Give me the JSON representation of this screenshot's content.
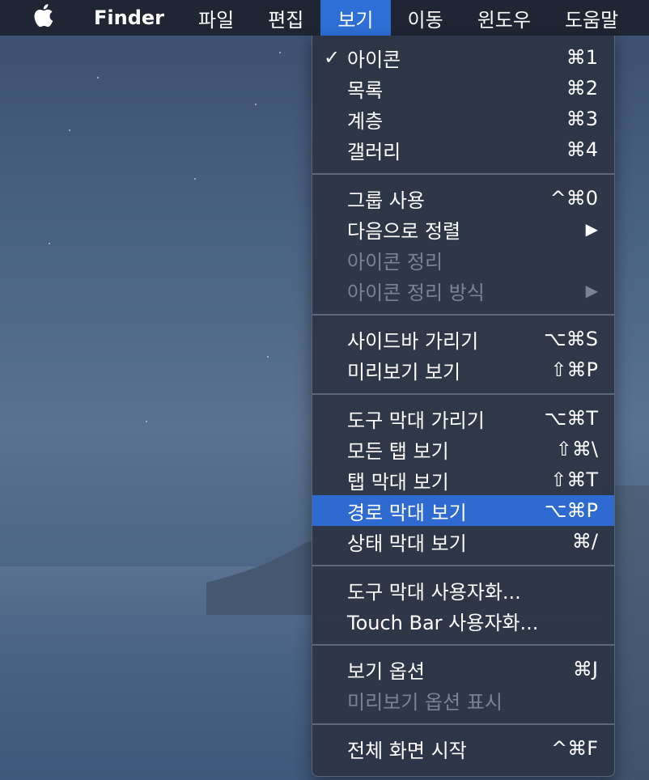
{
  "menubar": {
    "apple_icon": "apple-logo",
    "items": [
      "Finder",
      "파일",
      "편집",
      "보기",
      "이동",
      "윈도우",
      "도움말"
    ],
    "active_index": 3
  },
  "view_menu": {
    "groups": [
      [
        {
          "label": "아이콘",
          "shortcut": "⌘1",
          "checked": true,
          "disabled": false
        },
        {
          "label": "목록",
          "shortcut": "⌘2",
          "checked": false,
          "disabled": false
        },
        {
          "label": "계층",
          "shortcut": "⌘3",
          "checked": false,
          "disabled": false
        },
        {
          "label": "갤러리",
          "shortcut": "⌘4",
          "checked": false,
          "disabled": false
        }
      ],
      [
        {
          "label": "그룹 사용",
          "shortcut": "^⌘0",
          "checked": false,
          "disabled": false
        },
        {
          "label": "다음으로 정렬",
          "shortcut": "▶",
          "checked": false,
          "disabled": false
        },
        {
          "label": "아이콘 정리",
          "shortcut": "",
          "checked": false,
          "disabled": true
        },
        {
          "label": "아이콘 정리 방식",
          "shortcut": "▶",
          "checked": false,
          "disabled": true
        }
      ],
      [
        {
          "label": "사이드바 가리기",
          "shortcut": "⌥⌘S",
          "checked": false,
          "disabled": false
        },
        {
          "label": "미리보기 보기",
          "shortcut": "⇧⌘P",
          "checked": false,
          "disabled": false
        }
      ],
      [
        {
          "label": "도구 막대 가리기",
          "shortcut": "⌥⌘T",
          "checked": false,
          "disabled": false
        },
        {
          "label": "모든 탭 보기",
          "shortcut": "⇧⌘\\",
          "checked": false,
          "disabled": false
        },
        {
          "label": "탭 막대 보기",
          "shortcut": "⇧⌘T",
          "checked": false,
          "disabled": false
        },
        {
          "label": "경로 막대 보기",
          "shortcut": "⌥⌘P",
          "checked": false,
          "disabled": false,
          "highlighted": true
        },
        {
          "label": "상태 막대 보기",
          "shortcut": "⌘/",
          "checked": false,
          "disabled": false
        }
      ],
      [
        {
          "label": "도구 막대 사용자화...",
          "shortcut": "",
          "checked": false,
          "disabled": false
        },
        {
          "label": "Touch Bar 사용자화...",
          "shortcut": "",
          "checked": false,
          "disabled": false
        }
      ],
      [
        {
          "label": "보기 옵션",
          "shortcut": "⌘J",
          "checked": false,
          "disabled": false
        },
        {
          "label": "미리보기 옵션 표시",
          "shortcut": "",
          "checked": false,
          "disabled": true
        }
      ],
      [
        {
          "label": "전체 화면 시작",
          "shortcut": "^⌘F",
          "checked": false,
          "disabled": false
        }
      ]
    ],
    "check_glyph": "✓"
  },
  "colors": {
    "menubar_bg": "#1f2533",
    "highlight": "#2f6ad0",
    "active_menu": "#2d6fd6",
    "disabled_text": "#7a8294"
  }
}
